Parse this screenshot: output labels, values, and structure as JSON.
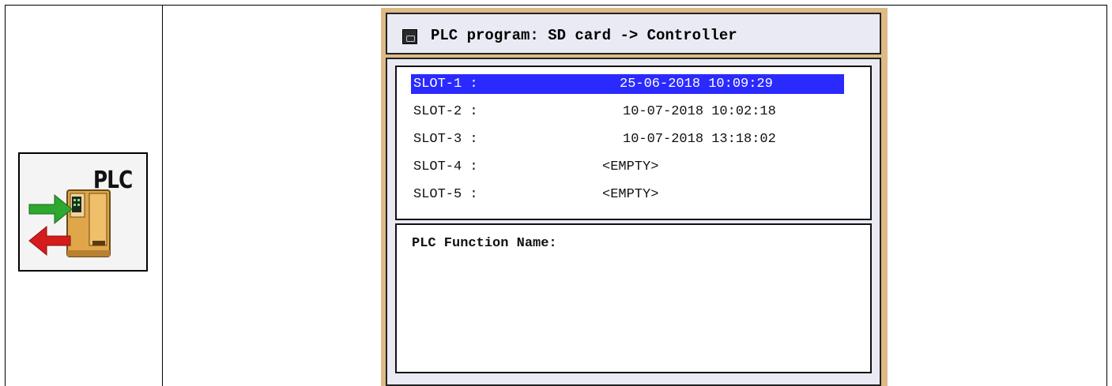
{
  "icon_tile": {
    "label": "PLC",
    "icon": "plc-transfer-icon",
    "colors": {
      "arrow_in": "#2ea82e",
      "arrow_out": "#d41c1c",
      "device": "#e0a64a"
    }
  },
  "screen": {
    "title": "PLC program: SD card -> Controller",
    "title_icon": "sd-card-icon",
    "slots": [
      {
        "name": "SLOT-1 :",
        "value": "25-06-2018 10:09:29",
        "selected": true
      },
      {
        "name": "SLOT-2 :",
        "value": "10-07-2018 10:02:18",
        "selected": false
      },
      {
        "name": "SLOT-3 :",
        "value": "10-07-2018 13:18:02",
        "selected": false
      },
      {
        "name": "SLOT-4 :",
        "value": "<EMPTY>",
        "selected": false
      },
      {
        "name": "SLOT-5 :",
        "value": "<EMPTY>",
        "selected": false
      }
    ],
    "function_label": "PLC Function Name:",
    "colors": {
      "frame": "#deba86",
      "panel": "#eaeaf4",
      "selection": "#2a2aff"
    }
  }
}
